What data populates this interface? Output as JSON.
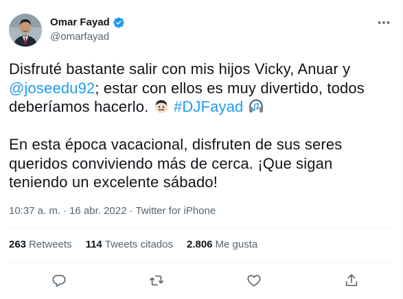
{
  "author": {
    "name": "Omar Fayad",
    "handle": "@omarfayad",
    "verified": true
  },
  "tweet": {
    "p1_a": "Disfruté bastante salir con mis hijos Vicky, Anuar y",
    "mention": "@joseedu92",
    "p1_b": "; estar con ellos es muy divertido, todos",
    "p1_c": "deberíamos hacerlo.",
    "hashtag": "#DJFayad",
    "p2": "En esta época vacacional, disfruten de sus seres\nqueridos conviviendo más de cerca. ¡Que sigan\nteniendo un excelente sábado!"
  },
  "meta": {
    "time": "10:37 a. m.",
    "separator": "·",
    "date": "16 abr. 2022",
    "source": "Twitter for iPhone"
  },
  "stats": {
    "retweets_count": "263",
    "retweets_label": "Retweets",
    "quotes_count": "114",
    "quotes_label": "Tweets citados",
    "likes_count": "2.806",
    "likes_label": "Me gusta"
  },
  "icons": {
    "verified": "verified-badge-icon",
    "more": "more-options-icon",
    "emoji_face": "man-face-emoji",
    "emoji_headphones": "headphones-emoji",
    "reply": "reply-icon",
    "retweet": "retweet-icon",
    "like": "like-icon",
    "share": "share-icon"
  },
  "colors": {
    "link": "#1d9bf0",
    "secondary_text": "#536471",
    "primary_text": "#0f1419",
    "divider": "#eff3f4"
  }
}
